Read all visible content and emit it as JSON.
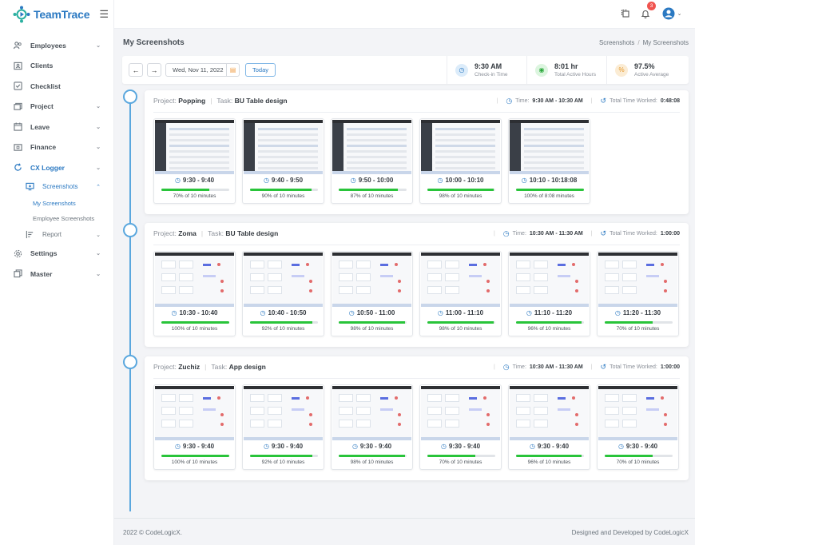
{
  "brand": {
    "name": "TeamTrace",
    "accent": "#2b79c2"
  },
  "sidebar": {
    "items": [
      {
        "label": "Employees",
        "icon": "users-icon",
        "chevron": true
      },
      {
        "label": "Clients",
        "icon": "id-card-icon",
        "chevron": false
      },
      {
        "label": "Checklist",
        "icon": "checkbox-icon",
        "chevron": false
      },
      {
        "label": "Project",
        "icon": "folder-icon",
        "chevron": true
      },
      {
        "label": "Leave",
        "icon": "calendar-icon",
        "chevron": true
      },
      {
        "label": "Finance",
        "icon": "wallet-icon",
        "chevron": true
      },
      {
        "label": "CX Logger",
        "icon": "refresh-icon",
        "chevron": true
      },
      {
        "label": "Settings",
        "icon": "gear-icon",
        "chevron": true
      },
      {
        "label": "Master",
        "icon": "layers-icon",
        "chevron": true
      }
    ],
    "screenshots_label": "Screenshots",
    "my_screenshots_label": "My Screenshots",
    "employee_screenshots_label": "Employee Screenshots",
    "report_label": "Report"
  },
  "header": {
    "notification_count": "3"
  },
  "page": {
    "title": "My Screenshots",
    "breadcrumb": [
      "Screenshots",
      "My Screenshots"
    ]
  },
  "toolbar": {
    "date": "Wed, Nov 11, 2022",
    "today_label": "Today",
    "stats": [
      {
        "value": "9:30 AM",
        "label": "Check-in Time",
        "color": "#2b79c2",
        "bg": "#dcecfa",
        "icon": "clock-icon"
      },
      {
        "value": "8:01 hr",
        "label": "Total Active Hours",
        "color": "#29a83a",
        "bg": "#dcf5df",
        "icon": "target-icon"
      },
      {
        "value": "97.5%",
        "label": "Active Average",
        "color": "#e69a2e",
        "bg": "#fbecd4",
        "icon": "percent-icon"
      }
    ]
  },
  "groups": [
    {
      "project_label": "Project:",
      "project": "Popping",
      "task_label": "Task:",
      "task": "BU Table design",
      "time_label": "Time:",
      "time": "9:30 AM - 10:30 AM",
      "total_label": "Total Time Worked:",
      "total": "0:48:08",
      "style": "dark",
      "shots": [
        {
          "time": "9:30 - 9:40",
          "progress": 0.7,
          "label": "70% of 10 minutes"
        },
        {
          "time": "9:40 - 9:50",
          "progress": 0.9,
          "label": "90% of 10 minutes"
        },
        {
          "time": "9:50 - 10:00",
          "progress": 0.87,
          "label": "87% of 10 minutes"
        },
        {
          "time": "10:00 - 10:10",
          "progress": 0.98,
          "label": "98% of 10 minutes"
        },
        {
          "time": "10:10 - 10:18:08",
          "progress": 1.0,
          "label": "100% of 8:08 minutes"
        }
      ]
    },
    {
      "project_label": "Project:",
      "project": "Zoma",
      "task_label": "Task:",
      "task": "BU Table design",
      "time_label": "Time:",
      "time": "10:30 AM - 11:30 AM",
      "total_label": "Total Time Worked:",
      "total": "1:00:00",
      "style": "light",
      "shots": [
        {
          "time": "10:30 - 10:40",
          "progress": 1.0,
          "label": "100% of 10 minutes"
        },
        {
          "time": "10:40 - 10:50",
          "progress": 0.92,
          "label": "92% of 10 minutes"
        },
        {
          "time": "10:50 - 11:00",
          "progress": 0.98,
          "label": "98% of 10 minutes"
        },
        {
          "time": "11:00 - 11:10",
          "progress": 0.98,
          "label": "98% of 10 minutes"
        },
        {
          "time": "11:10 - 11:20",
          "progress": 0.96,
          "label": "96% of 10 minutes"
        },
        {
          "time": "11:20 - 11:30",
          "progress": 0.7,
          "label": "70% of 10 minutes"
        }
      ]
    },
    {
      "project_label": "Project:",
      "project": "Zuchiz",
      "task_label": "Task:",
      "task": "App design",
      "time_label": "Time:",
      "time": "10:30 AM - 11:30 AM",
      "total_label": "Total Time Worked:",
      "total": "1:00:00",
      "style": "light",
      "shots": [
        {
          "time": "9:30 - 9:40",
          "progress": 1.0,
          "label": "100% of 10 minutes"
        },
        {
          "time": "9:30 - 9:40",
          "progress": 0.92,
          "label": "92% of 10 minutes"
        },
        {
          "time": "9:30 - 9:40",
          "progress": 0.98,
          "label": "98% of 10 minutes"
        },
        {
          "time": "9:30 - 9:40",
          "progress": 0.7,
          "label": "70% of 10 minutes"
        },
        {
          "time": "9:30 - 9:40",
          "progress": 0.96,
          "label": "96% of 10 minutes"
        },
        {
          "time": "9:30 - 9:40",
          "progress": 0.7,
          "label": "70% of 10 minutes"
        }
      ]
    }
  ],
  "footer": {
    "left": "2022 © CodeLogicX.",
    "right": "Designed and Developed by CodeLogicX"
  }
}
